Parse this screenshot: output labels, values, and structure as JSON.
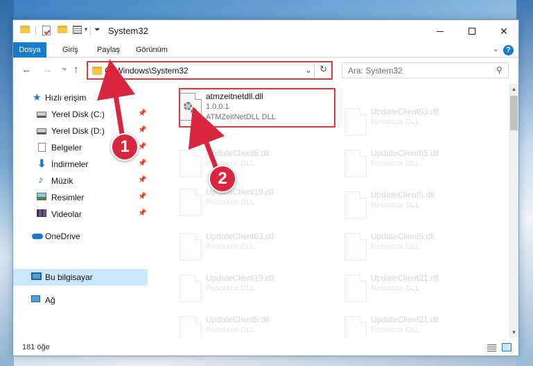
{
  "titlebar": {
    "title": "System32",
    "minimize_icon": "minimize-icon",
    "maximize_icon": "maximize-icon",
    "close_label": "✕"
  },
  "ribbon": {
    "tabs": [
      {
        "label": "Dosya",
        "active": true
      },
      {
        "label": "Giriş",
        "active": false
      },
      {
        "label": "Paylaş",
        "active": false
      },
      {
        "label": "Görünüm",
        "active": false
      }
    ],
    "help_label": "?"
  },
  "navigation": {
    "back": "←",
    "forward": "→",
    "recent": "⌄",
    "up": "↑",
    "address": "C:\\Windows\\System32",
    "refresh": "↻",
    "search_placeholder": "Ara: System32"
  },
  "sidebar": {
    "items": [
      {
        "label": "Hızlı erişim",
        "icon": "star-icon"
      },
      {
        "label": "Yerel Disk (C:)",
        "icon": "drive-icon",
        "pinned": true
      },
      {
        "label": "Yerel Disk (D:)",
        "icon": "drive-icon",
        "pinned": true
      },
      {
        "label": "Belgeler",
        "icon": "documents-icon",
        "pinned": true
      },
      {
        "label": "İndirmeler",
        "icon": "download-icon",
        "pinned": true
      },
      {
        "label": "Müzik",
        "icon": "music-icon",
        "pinned": true
      },
      {
        "label": "Resimler",
        "icon": "pictures-icon",
        "pinned": true
      },
      {
        "label": "Videolar",
        "icon": "videos-icon",
        "pinned": true
      },
      {
        "label": "OneDrive",
        "icon": "cloud-icon"
      },
      {
        "label": "Bu bilgisayar",
        "icon": "computer-icon",
        "selected": true
      },
      {
        "label": "Ağ",
        "icon": "network-icon"
      }
    ]
  },
  "files": {
    "highlighted": {
      "name": "atmzeitnetdll.dll",
      "version": "1.0.0.1",
      "description": "ATMZeitNetDLL DLL"
    },
    "faded_left": [
      {
        "name": "UpdateClient5.dll",
        "type": "Resource DLL"
      },
      {
        "name": "UpdateClient19.dll",
        "type": "Resource DLL"
      },
      {
        "name": "UpdateClient63.dll",
        "type": "Resource DLL"
      },
      {
        "name": "UpdateClient19.dll",
        "type": "Resource DLL"
      },
      {
        "name": "UpdateClient5.dll",
        "type": "Resource DLL"
      }
    ],
    "faded_right": [
      {
        "name": "UpdateClient63.dll",
        "type": "Resource DLL"
      },
      {
        "name": "UpdateClient65.dll",
        "type": "Resource DLL"
      },
      {
        "name": "UpdateClient5.dll",
        "type": "Resource DLL"
      },
      {
        "name": "UpdateClient5.dll",
        "type": "Resource DLL"
      },
      {
        "name": "UpdateClient21.dll",
        "type": "Resource DLL"
      },
      {
        "name": "UpdateClient21.dll",
        "type": "Resource DLL"
      }
    ]
  },
  "statusbar": {
    "item_count": "181 öğe"
  },
  "annotations": {
    "marker1": "1",
    "marker2": "2",
    "color": "#d7263d"
  }
}
